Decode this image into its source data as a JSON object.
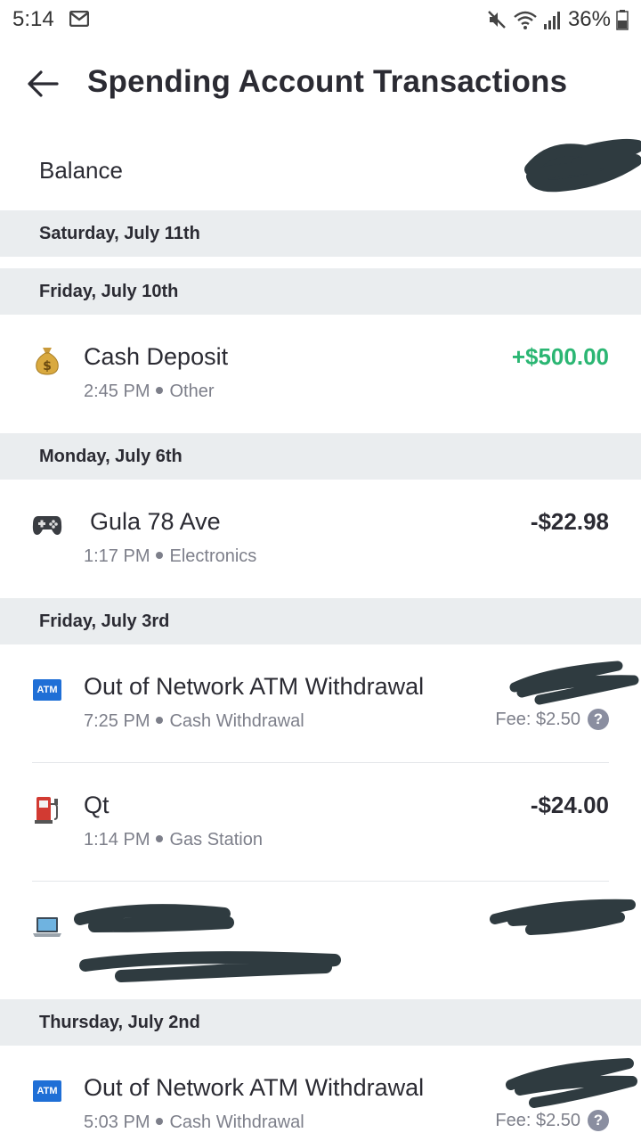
{
  "status_bar": {
    "time": "5:14",
    "battery": "36%",
    "icons": [
      "mail-icon",
      "mute-icon",
      "wifi-icon",
      "signal-icon",
      "battery-icon"
    ]
  },
  "header": {
    "title": "Spending Account Transactions",
    "back_icon": "arrow-left-icon"
  },
  "balance": {
    "label": "Balance"
  },
  "colors": {
    "positive": "#2bb673",
    "section_bg": "#eaedef",
    "text": "#2b2b33",
    "muted": "#7d7f8a",
    "atm_blue": "#1f6fd6"
  },
  "sections": [
    {
      "date": "Saturday, July 11th",
      "transactions": []
    },
    {
      "date": "Friday, July 10th",
      "transactions": [
        {
          "icon": "money-bag-icon",
          "name": "Cash Deposit",
          "time": "2:45 PM",
          "category": "Other",
          "amount": "+$500.00"
        }
      ]
    },
    {
      "date": "Monday, July 6th",
      "transactions": [
        {
          "icon": "game-controller-icon",
          "name": "Gula 78 Ave",
          "time": "1:17 PM",
          "category": "Electronics",
          "amount": "-$22.98"
        }
      ]
    },
    {
      "date": "Friday, July 3rd",
      "transactions": [
        {
          "icon": "atm-icon",
          "icon_text": "ATM",
          "name": "Out of Network ATM Withdrawal",
          "time": "7:25 PM",
          "category": "Cash Withdrawal",
          "fee": "Fee: $2.50"
        },
        {
          "icon": "fuel-pump-icon",
          "name": "Qt",
          "time": "1:14 PM",
          "category": "Gas Station",
          "amount": "-$24.00"
        },
        {
          "icon": "laptop-icon"
        }
      ]
    },
    {
      "date": "Thursday, July 2nd",
      "transactions": [
        {
          "icon": "atm-icon",
          "icon_text": "ATM",
          "name": "Out of Network ATM Withdrawal",
          "time": "5:03 PM",
          "category": "Cash Withdrawal",
          "fee": "Fee: $2.50"
        }
      ]
    }
  ],
  "help_glyph": "?"
}
